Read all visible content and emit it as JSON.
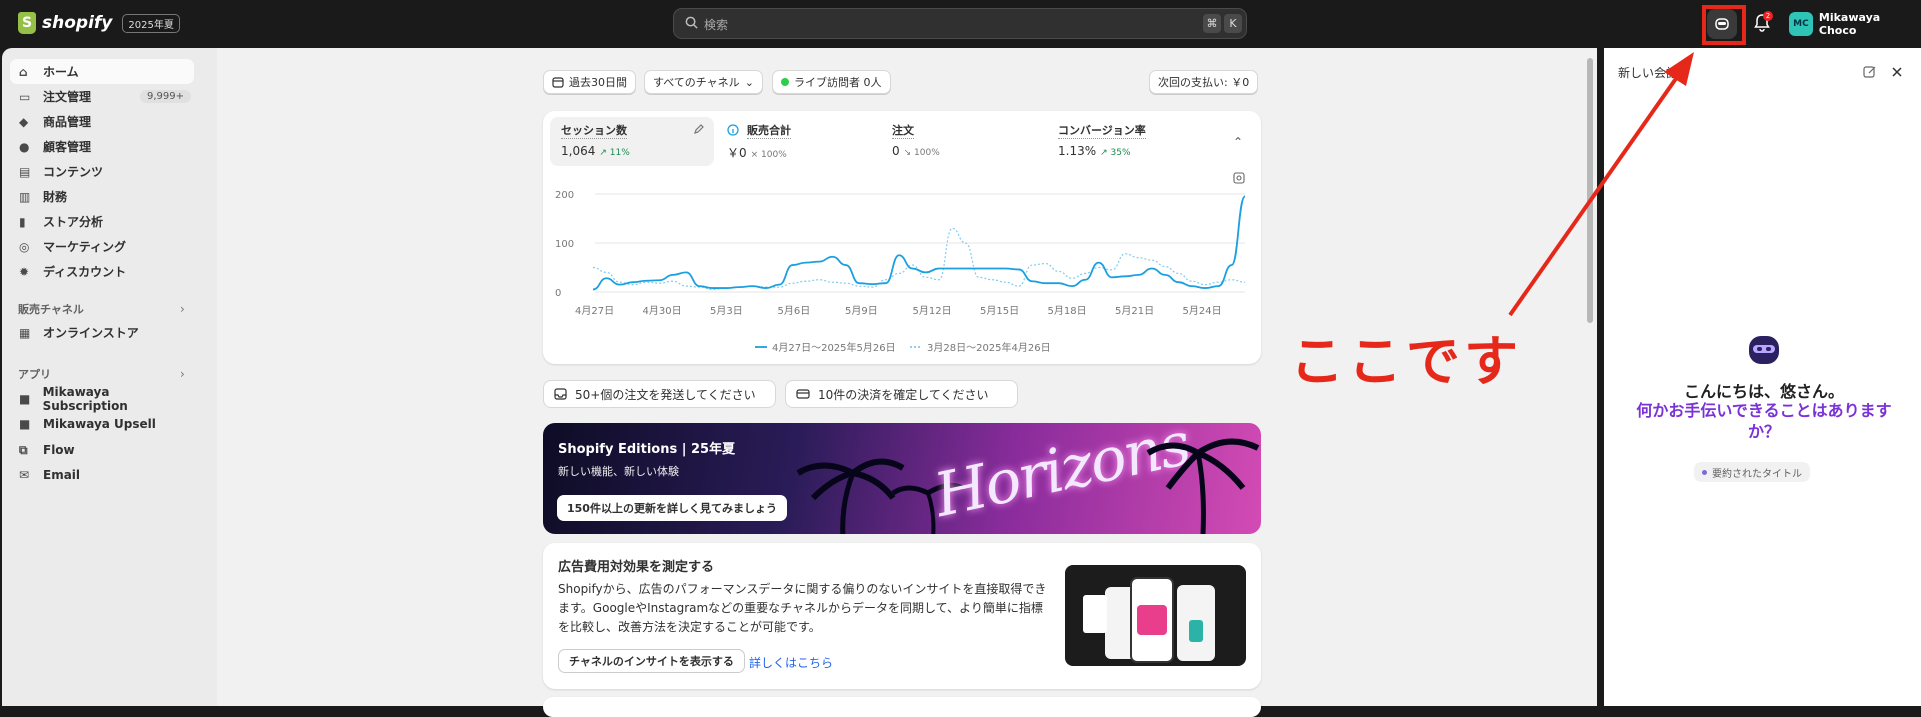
{
  "topbar": {
    "logo_text": "shopify",
    "edition": "2025年夏",
    "search_placeholder": "検索",
    "shortcut_keys": [
      "⌘",
      "K"
    ],
    "notification_count": "2",
    "user_initials": "MC",
    "user_name": "Mikawaya Choco"
  },
  "sidebar": {
    "items": [
      {
        "label": "ホーム",
        "icon": "home-icon"
      },
      {
        "label": "注文管理",
        "icon": "inbox-icon",
        "count": "9,999+"
      },
      {
        "label": "商品管理",
        "icon": "tag-icon"
      },
      {
        "label": "顧客管理",
        "icon": "person-icon"
      },
      {
        "label": "コンテンツ",
        "icon": "content-icon"
      },
      {
        "label": "財務",
        "icon": "bank-icon"
      },
      {
        "label": "ストア分析",
        "icon": "bar-chart-icon"
      },
      {
        "label": "マーケティング",
        "icon": "target-icon"
      },
      {
        "label": "ディスカウント",
        "icon": "discount-icon"
      }
    ],
    "sales_channels_label": "販売チャネル",
    "channels": [
      {
        "label": "オンラインストア",
        "icon": "store-icon"
      }
    ],
    "apps_label": "アプリ",
    "apps": [
      {
        "label": "Mikawaya Subscription",
        "icon": "app-icon"
      },
      {
        "label": "Mikawaya Upsell",
        "icon": "app-icon"
      },
      {
        "label": "Flow",
        "icon": "flow-icon"
      },
      {
        "label": "Email",
        "icon": "email-icon"
      }
    ]
  },
  "filters": {
    "date_range": "過去30日間",
    "channel": "すべてのチャネル",
    "live_visitors": "ライブ訪問者 0人",
    "next_payment": "次回の支払い: ￥0"
  },
  "metrics": [
    {
      "label": "セッション数",
      "value": "1,064",
      "change": "↗ 11%"
    },
    {
      "label": "販売合計",
      "value": "￥0",
      "change": "× 100%"
    },
    {
      "label": "注文",
      "value": "0",
      "change": "↘ 100%"
    },
    {
      "label": "コンバージョン率",
      "value": "1.13%",
      "change": "↗ 35%"
    }
  ],
  "chart_data": {
    "type": "line",
    "ylim": [
      0,
      200
    ],
    "y_ticks": [
      "200",
      "100",
      "0"
    ],
    "x_ticks": [
      "4月27日",
      "4月30日",
      "5月3日",
      "5月6日",
      "5月9日",
      "5月12日",
      "5月15日",
      "5月18日",
      "5月21日",
      "5月24日"
    ],
    "series": [
      {
        "name": "4月27日〜2025年5月26日",
        "style": "solid",
        "color": "#1b9fe0",
        "values": [
          5,
          28,
          15,
          20,
          23,
          24,
          35,
          40,
          12,
          8,
          8,
          10,
          12,
          8,
          15,
          55,
          60,
          62,
          72,
          55,
          18,
          16,
          18,
          75,
          48,
          40,
          48,
          48,
          48,
          48,
          48,
          48,
          46,
          22,
          18,
          18,
          12,
          25,
          60,
          30,
          32,
          35,
          48,
          35,
          20,
          12,
          8,
          12,
          55,
          195
        ]
      },
      {
        "name": "3月28日〜2025年4月26日",
        "style": "dotted",
        "color": "#7fcbef",
        "values": [
          50,
          40,
          20,
          15,
          20,
          18,
          22,
          12,
          10,
          5,
          8,
          10,
          12,
          10,
          10,
          18,
          22,
          25,
          20,
          18,
          12,
          10,
          25,
          38,
          55,
          30,
          25,
          130,
          100,
          30,
          25,
          20,
          12,
          55,
          58,
          42,
          28,
          38,
          50,
          45,
          78,
          70,
          65,
          52,
          38,
          22,
          15,
          20,
          25,
          20
        ]
      }
    ]
  },
  "tasks": [
    {
      "label": "50+個の注文を発送してください",
      "icon": "inbox-icon"
    },
    {
      "label": "10件の決済を確定してください",
      "icon": "payment-icon"
    }
  ],
  "banner": {
    "title": "Shopify Editions | 25年夏",
    "subtitle": "新しい機能、新しい体験",
    "button": "150件以上の更新を詳しく見てみましょう",
    "art_text": "Horizons"
  },
  "ads": {
    "title": "広告費用対効果を測定する",
    "description": "Shopifyから、広告のパフォーマンスデータに関する偏りのないインサイトを直接取得できます。GoogleやInstagramなどの重要なチャネルからデータを同期して、より簡単に指標を比較し、改善方法を決定することが可能です。",
    "button": "チャネルのインサイトを表示する",
    "link": "詳しくはこちら"
  },
  "assistant": {
    "title": "新しい会話",
    "greeting": "こんにちは、悠さん。",
    "prompt": "何かお手伝いできることはありますか？",
    "suggestion": "要約されたタイトル"
  },
  "annotation": {
    "text": "ここです",
    "color": "#e5281a"
  }
}
